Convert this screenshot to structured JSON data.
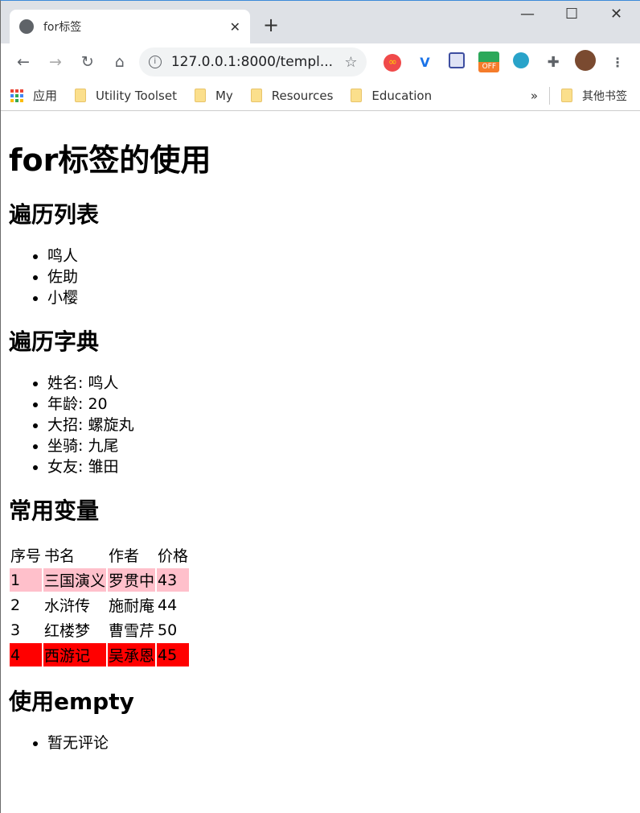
{
  "browser": {
    "tab_title": "for标签",
    "url": "127.0.0.1:8000/templ...",
    "bookmarks": [
      "应用",
      "Utility Toolset",
      "My",
      "Resources",
      "Education"
    ],
    "overflow": "»",
    "other_bookmarks": "其他书签"
  },
  "page": {
    "title": "for标签的使用",
    "section1": {
      "heading": "遍历列表",
      "items": [
        "鸣人",
        "佐助",
        "小樱"
      ]
    },
    "section2": {
      "heading": "遍历字典",
      "items": [
        "姓名: 鸣人",
        "年龄: 20",
        "大招: 螺旋丸",
        "坐骑: 九尾",
        "女友: 雏田"
      ]
    },
    "section3": {
      "heading": "常用变量",
      "headers": [
        "序号",
        "书名",
        "作者",
        "价格"
      ],
      "rows": [
        [
          "1",
          "三国演义",
          "罗贯中",
          "43"
        ],
        [
          "2",
          "水浒传",
          "施耐庵",
          "44"
        ],
        [
          "3",
          "红楼梦",
          "曹雪芹",
          "50"
        ],
        [
          "4",
          "西游记",
          "吴承恩",
          "45"
        ]
      ],
      "row_colors": [
        "#ffc0cb",
        "",
        "",
        "#ff0000"
      ]
    },
    "section4": {
      "heading": "使用empty",
      "items": [
        "暂无评论"
      ]
    }
  }
}
